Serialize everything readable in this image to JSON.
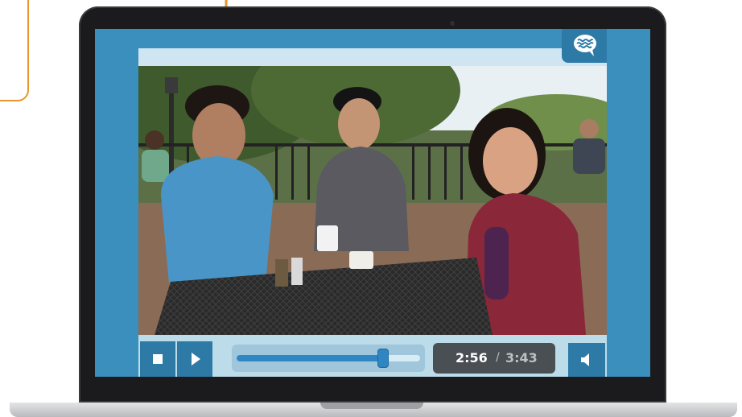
{
  "player": {
    "time_current": "2:56",
    "time_separator": "/",
    "time_total": "3:43",
    "progress": 0.8
  },
  "icons": {
    "chat": "chat-bubble-icon",
    "stop": "stop-icon",
    "play": "play-icon",
    "volume": "speaker-icon"
  },
  "colors": {
    "accent_orange": "#e8962e",
    "player_blue": "#3a8fbd",
    "button_blue": "#2d7aa7",
    "progress_blue": "#2f86c2",
    "time_box": "#4a4f54"
  }
}
